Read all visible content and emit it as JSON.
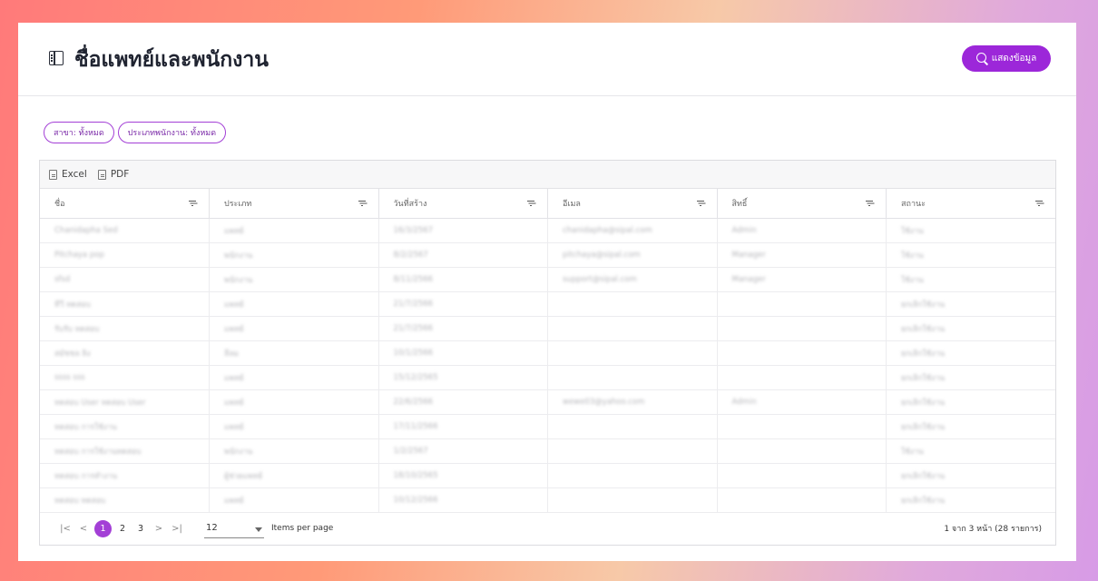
{
  "header": {
    "title": "ชื่อแพทย์และพนักงาน",
    "show_button": "แสดงข้อมูล"
  },
  "filters": [
    {
      "label": "สาขา: ทั้งหมด"
    },
    {
      "label": "ประเภทพนักงาน: ทั้งหมด"
    }
  ],
  "toolbar": {
    "excel": "Excel",
    "pdf": "PDF"
  },
  "columns": [
    "ชื่อ",
    "ประเภท",
    "วันที่สร้าง",
    "อีเมล",
    "สิทธิ์",
    "สถานะ"
  ],
  "rows": [
    [
      "Chanidapha Sed",
      "แพทย์",
      "16/3/2567",
      "chanidapha@sipal.com",
      "Admin",
      "ใช้งาน"
    ],
    [
      "Pitchaya pop",
      "พนักงาน",
      "8/2/2567",
      "pitchaya@sipal.com",
      "Manager",
      "ใช้งาน"
    ],
    [
      "sfsd",
      "พนักงาน",
      "8/11/2566",
      "support@sipal.com",
      "Manager",
      "ใช้งาน"
    ],
    [
      "ทีวี ทดสอบ",
      "แพทย์",
      "21/7/2566",
      "",
      "",
      "ยกเลิกใช้งาน"
    ],
    [
      "รับรับ ทดสอบ",
      "แพทย์",
      "21/7/2566",
      "",
      "",
      "ยกเลิกใช้งาน"
    ],
    [
      "สมัชชล ลิง",
      "ลีลม",
      "10/1/2566",
      "",
      "",
      "ยกเลิกใช้งาน"
    ],
    [
      "ssss sss",
      "แพทย์",
      "15/12/2565",
      "",
      "",
      "ยกเลิกใช้งาน"
    ],
    [
      "ทดสอบ User ทดสอบ User",
      "แพทย์",
      "22/6/2566",
      "wewe03@yahoo.com",
      "Admin",
      "ยกเลิกใช้งาน"
    ],
    [
      "ทดสอบ การใช้งาน",
      "แพทย์",
      "17/11/2566",
      "",
      "",
      "ยกเลิกใช้งาน"
    ],
    [
      "ทดสอบ การใช้งานทดสอบ",
      "พนักงาน",
      "1/2/2567",
      "",
      "",
      "ใช้งาน"
    ],
    [
      "ทดสอบ การทำงาน",
      "ผู้ช่วยแพทย์",
      "18/10/2565",
      "",
      "",
      "ยกเลิกใช้งาน"
    ],
    [
      "ทดสอบ ทดสอบ",
      "แพทย์",
      "10/12/2566",
      "",
      "",
      "ยกเลิกใช้งาน"
    ]
  ],
  "pagination": {
    "first": "|<",
    "prev": "<",
    "next": ">",
    "last": ">|",
    "pages": [
      "1",
      "2",
      "3"
    ],
    "current": "1",
    "page_size": "12",
    "items_per_page": "Items per page",
    "range": "1 จาก 3 หน้า (28 รายการ)"
  }
}
